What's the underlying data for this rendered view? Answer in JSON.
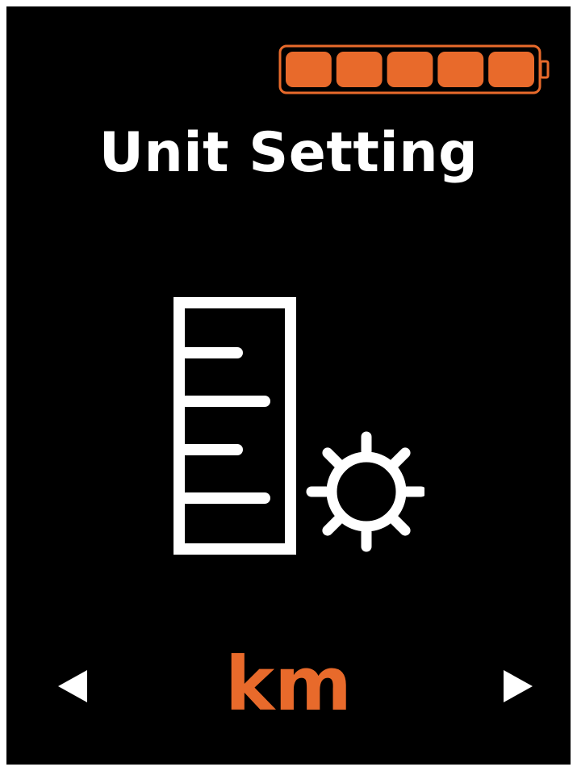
{
  "screen": {
    "title": "Unit Setting",
    "battery": {
      "icon": "battery-icon",
      "level_fraction": 1.0,
      "segments_filled": 5,
      "segments_total": 5
    },
    "main_icon": "ruler-gear-icon",
    "selector": {
      "value": "km",
      "prev_icon": "arrow-left-icon",
      "next_icon": "arrow-right-icon"
    }
  },
  "colors": {
    "background": "#000000",
    "text": "#ffffff",
    "accent": "#e86a2b"
  }
}
